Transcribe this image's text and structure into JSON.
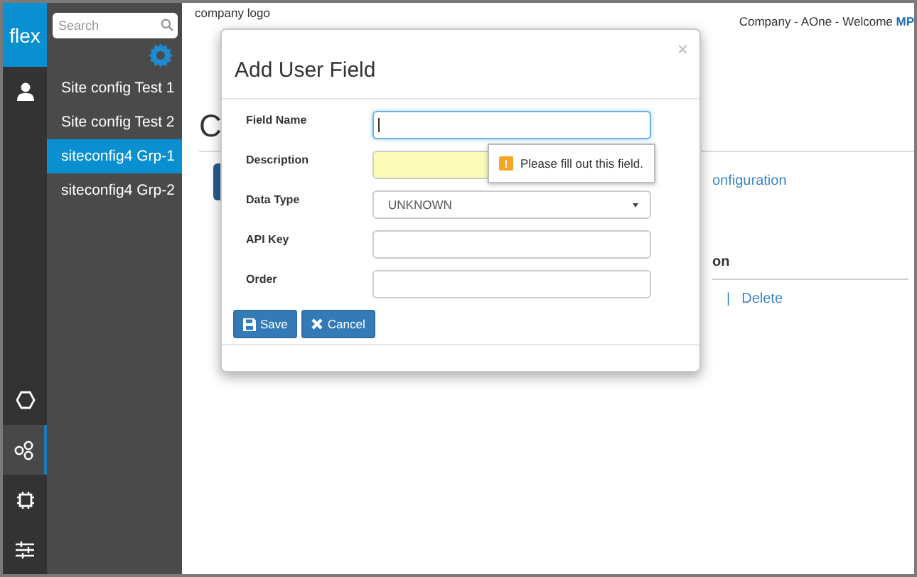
{
  "rail": {
    "logo": "flex",
    "top_items": [
      {
        "kind": "user",
        "selected": false
      }
    ],
    "bottom_items": [
      {
        "kind": "hexagon",
        "selected": false
      },
      {
        "kind": "nodes",
        "selected": true
      },
      {
        "kind": "chip",
        "selected": false
      },
      {
        "kind": "sliders",
        "selected": false
      }
    ]
  },
  "sidebar": {
    "search": {
      "placeholder": "Search"
    },
    "items": [
      {
        "label": "Site config Test 1",
        "selected": false
      },
      {
        "label": "Site config Test 2",
        "selected": false
      },
      {
        "label": "siteconfig4 Grp-1",
        "selected": true
      },
      {
        "label": "siteconfig4 Grp-2",
        "selected": false
      }
    ]
  },
  "header": {
    "logo_text": "company logo",
    "welcome": "Company - AOne - Welcome **MP**"
  },
  "page": {
    "heading": "C",
    "link": "onfiguration",
    "column_header": "on",
    "separator": "|",
    "action": "Delete"
  },
  "modal": {
    "title": "Add User Field",
    "close": "×",
    "fields": [
      {
        "label": "Field Name",
        "kind": "text",
        "focused": true,
        "highlighted": false
      },
      {
        "label": "Description",
        "kind": "text",
        "focused": false,
        "highlighted": true
      },
      {
        "label": "Data Type",
        "kind": "select",
        "value": "UNKNOWN",
        "focused": false,
        "highlighted": false
      },
      {
        "label": "API Key",
        "kind": "text",
        "focused": false,
        "highlighted": false
      },
      {
        "label": "Order",
        "kind": "text",
        "focused": false,
        "highlighted": false
      }
    ],
    "tooltip": {
      "mark": "!",
      "text": "Please fill out this field."
    },
    "buttons": [
      {
        "label": "Save",
        "kind": "save"
      },
      {
        "label": "Cancel",
        "kind": "cancel"
      }
    ]
  }
}
